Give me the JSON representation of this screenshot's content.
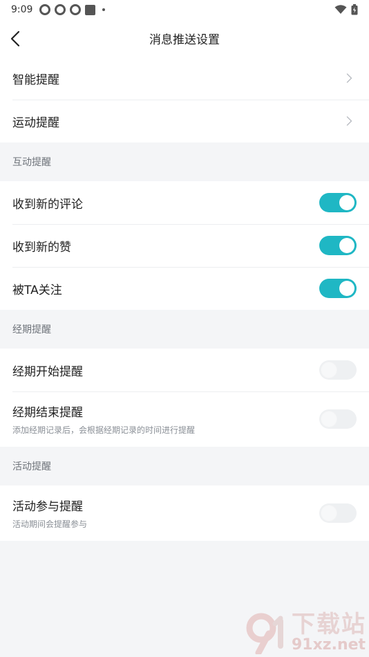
{
  "status_bar": {
    "time": "9:09"
  },
  "nav": {
    "title": "消息推送设置"
  },
  "group1": {
    "items": [
      {
        "label": "智能提醒"
      },
      {
        "label": "运动提醒"
      }
    ]
  },
  "interaction": {
    "header": "互动提醒",
    "items": [
      {
        "label": "收到新的评论",
        "enabled": true
      },
      {
        "label": "收到新的赞",
        "enabled": true
      },
      {
        "label": "被TA关注",
        "enabled": true
      }
    ]
  },
  "period": {
    "header": "经期提醒",
    "items": [
      {
        "label": "经期开始提醒",
        "enabled": false
      },
      {
        "label": "经期结束提醒",
        "sub": "添加经期记录后，会根据经期记录的时间进行提醒",
        "enabled": false
      }
    ]
  },
  "activity": {
    "header": "活动提醒",
    "items": [
      {
        "label": "活动参与提醒",
        "sub": "活动期间会提醒参与",
        "enabled": false
      }
    ]
  },
  "watermark": {
    "main": "下载站",
    "sub": "91xz.net"
  },
  "colors": {
    "accent": "#1fb7c4",
    "background": "#f4f5f7"
  }
}
